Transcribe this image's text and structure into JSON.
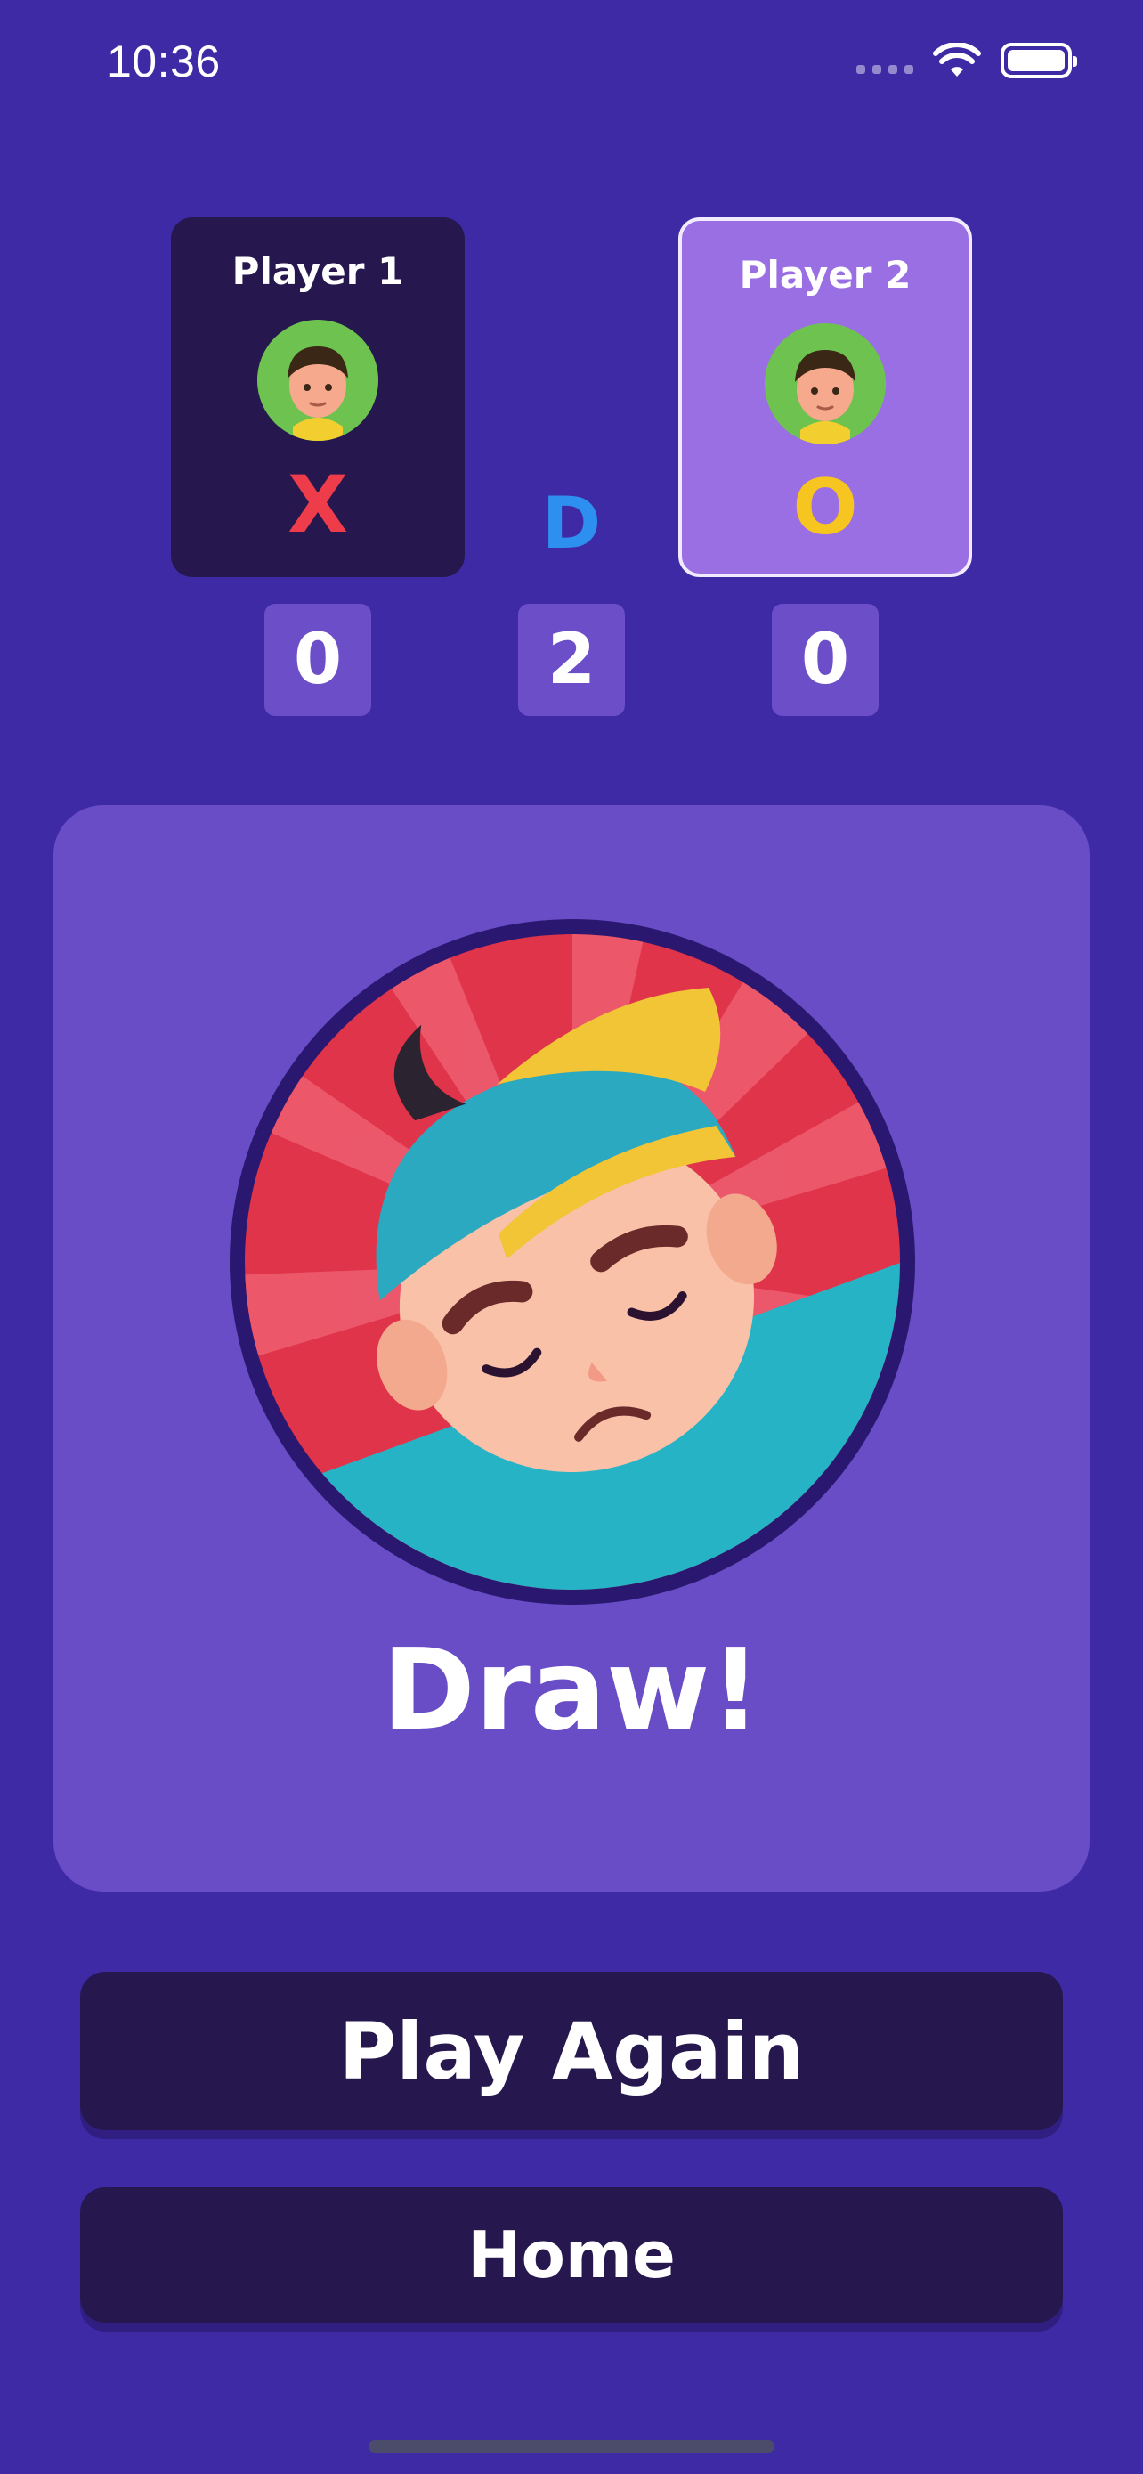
{
  "status_bar": {
    "time": "10:36",
    "icons": [
      "signal-icon",
      "wifi-icon",
      "battery-icon"
    ]
  },
  "players": [
    {
      "name": "Player 1",
      "mark": "X",
      "mark_color": "#ee3c4b",
      "active": false
    },
    {
      "name": "Player 2",
      "mark": "O",
      "mark_color": "#f7c51f",
      "active": true
    }
  ],
  "draw_label": "D",
  "scores": {
    "player1": "0",
    "draws": "2",
    "player2": "0"
  },
  "result": {
    "text": "Draw!"
  },
  "buttons": {
    "play_again": "Play Again",
    "home": "Home"
  },
  "colors": {
    "background": "#3f2aa6",
    "panel": "#684dc6",
    "card_dark": "#26184f",
    "card_active": "#9a6fe3",
    "draw_blue": "#2d8ff0"
  }
}
